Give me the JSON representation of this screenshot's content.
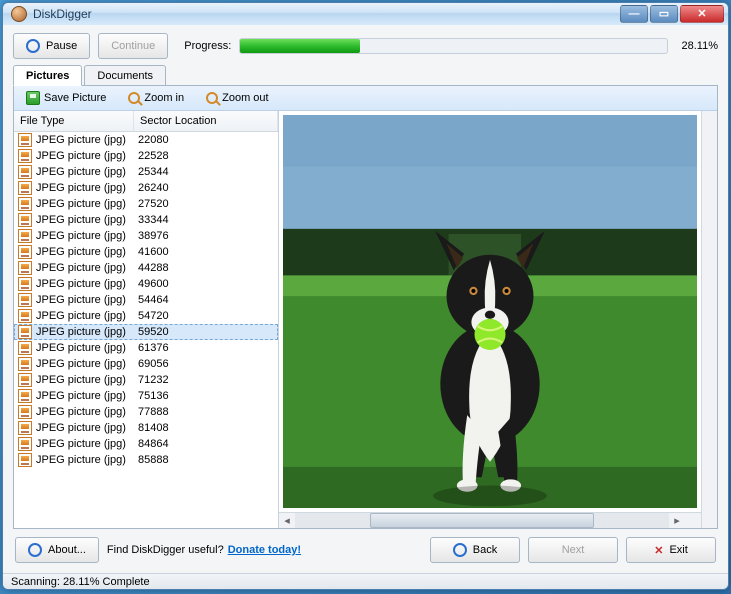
{
  "window": {
    "title": "DiskDigger"
  },
  "topbar": {
    "pause_label": "Pause",
    "continue_label": "Continue",
    "progress_label": "Progress:",
    "progress_pct": "28.11%",
    "progress_value": 28.11
  },
  "tabs": {
    "pictures_label": "Pictures",
    "documents_label": "Documents"
  },
  "toolbar": {
    "save_label": "Save Picture",
    "zoomin_label": "Zoom in",
    "zoomout_label": "Zoom out"
  },
  "list": {
    "col_filetype": "File Type",
    "col_sector": "Sector Location",
    "rows": [
      {
        "ft": "JPEG picture (jpg)",
        "sec": "22080"
      },
      {
        "ft": "JPEG picture (jpg)",
        "sec": "22528"
      },
      {
        "ft": "JPEG picture (jpg)",
        "sec": "25344"
      },
      {
        "ft": "JPEG picture (jpg)",
        "sec": "26240"
      },
      {
        "ft": "JPEG picture (jpg)",
        "sec": "27520"
      },
      {
        "ft": "JPEG picture (jpg)",
        "sec": "33344"
      },
      {
        "ft": "JPEG picture (jpg)",
        "sec": "38976"
      },
      {
        "ft": "JPEG picture (jpg)",
        "sec": "41600"
      },
      {
        "ft": "JPEG picture (jpg)",
        "sec": "44288"
      },
      {
        "ft": "JPEG picture (jpg)",
        "sec": "49600"
      },
      {
        "ft": "JPEG picture (jpg)",
        "sec": "54464"
      },
      {
        "ft": "JPEG picture (jpg)",
        "sec": "54720"
      },
      {
        "ft": "JPEG picture (jpg)",
        "sec": "59520",
        "selected": true
      },
      {
        "ft": "JPEG picture (jpg)",
        "sec": "61376"
      },
      {
        "ft": "JPEG picture (jpg)",
        "sec": "69056"
      },
      {
        "ft": "JPEG picture (jpg)",
        "sec": "71232"
      },
      {
        "ft": "JPEG picture (jpg)",
        "sec": "75136"
      },
      {
        "ft": "JPEG picture (jpg)",
        "sec": "77888"
      },
      {
        "ft": "JPEG picture (jpg)",
        "sec": "81408"
      },
      {
        "ft": "JPEG picture (jpg)",
        "sec": "84864"
      },
      {
        "ft": "JPEG picture (jpg)",
        "sec": "85888"
      }
    ]
  },
  "bottom": {
    "about_label": "About...",
    "useful_text": "Find DiskDigger useful?",
    "donate_label": "Donate today!",
    "back_label": "Back",
    "next_label": "Next",
    "exit_label": "Exit"
  },
  "status": {
    "text": "Scanning: 28.11% Complete"
  }
}
